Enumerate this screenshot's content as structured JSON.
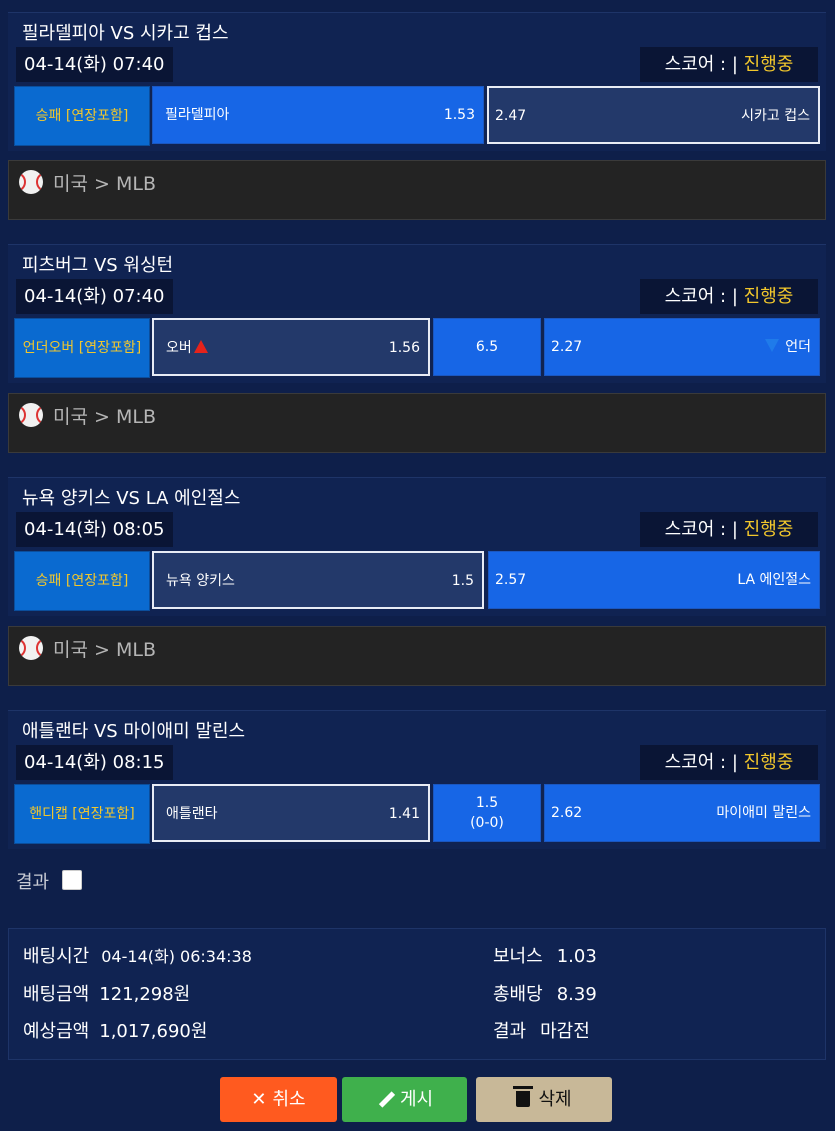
{
  "matches": [
    {
      "title": "필라델피아 VS 시카고 컵스",
      "datetime": "04-14(화) 07:40",
      "score_label": "스코어 : |",
      "status": "진행중",
      "bet_type": "승패 [연장포함]",
      "home": {
        "name": "필라델피아",
        "odds": "1.53",
        "selected": false
      },
      "away": {
        "name": "시카고 컵스",
        "odds": "2.47",
        "selected": true
      },
      "league": "미국 > MLB"
    },
    {
      "title": "피츠버그 VS 워싱턴",
      "datetime": "04-14(화) 07:40",
      "score_label": "스코어 : |",
      "status": "진행중",
      "bet_type": "언더오버 [연장포함]",
      "home": {
        "name": "오버",
        "odds": "1.56",
        "selected": true
      },
      "mid": {
        "line1": "6.5"
      },
      "away": {
        "name": "언더",
        "odds": "2.27",
        "selected": false
      },
      "league": "미국 > MLB"
    },
    {
      "title": "뉴욕 양키스 VS LA 에인절스",
      "datetime": "04-14(화) 08:05",
      "score_label": "스코어 : |",
      "status": "진행중",
      "bet_type": "승패 [연장포함]",
      "home": {
        "name": "뉴욕 양키스",
        "odds": "1.5",
        "selected": true
      },
      "away": {
        "name": "LA 에인절스",
        "odds": "2.57",
        "selected": false
      },
      "league": "미국 > MLB"
    },
    {
      "title": "애틀랜타 VS 마이애미 말린스",
      "datetime": "04-14(화) 08:15",
      "score_label": "스코어 : |",
      "status": "진행중",
      "bet_type": "핸디캡 [연장포함]",
      "home": {
        "name": "애틀랜타",
        "odds": "1.41",
        "selected": true
      },
      "mid": {
        "line1": "1.5",
        "line2": "(0-0)"
      },
      "away": {
        "name": "마이애미 말린스",
        "odds": "2.62",
        "selected": false
      }
    }
  ],
  "result_filter": {
    "label": "결과",
    "checked": false
  },
  "summary": {
    "bet_time_label": "배팅시간",
    "bet_time": "04-14(화) 06:34:38",
    "bet_amount_label": "배팅금액",
    "bet_amount": "121,298원",
    "expected_label": "예상금액",
    "expected": "1,017,690원",
    "bonus_label": "보너스",
    "bonus": "1.03",
    "total_odds_label": "총배당",
    "total_odds": "8.39",
    "result_label": "결과",
    "result": "마감전"
  },
  "buttons": {
    "cancel_icon": "✕",
    "cancel": "취소",
    "post": "게시",
    "delete": "삭제"
  },
  "colors": {
    "accent_yellow": "#f2c72c",
    "cell_blue": "#1766e6",
    "selected_cell": "#23396a"
  }
}
